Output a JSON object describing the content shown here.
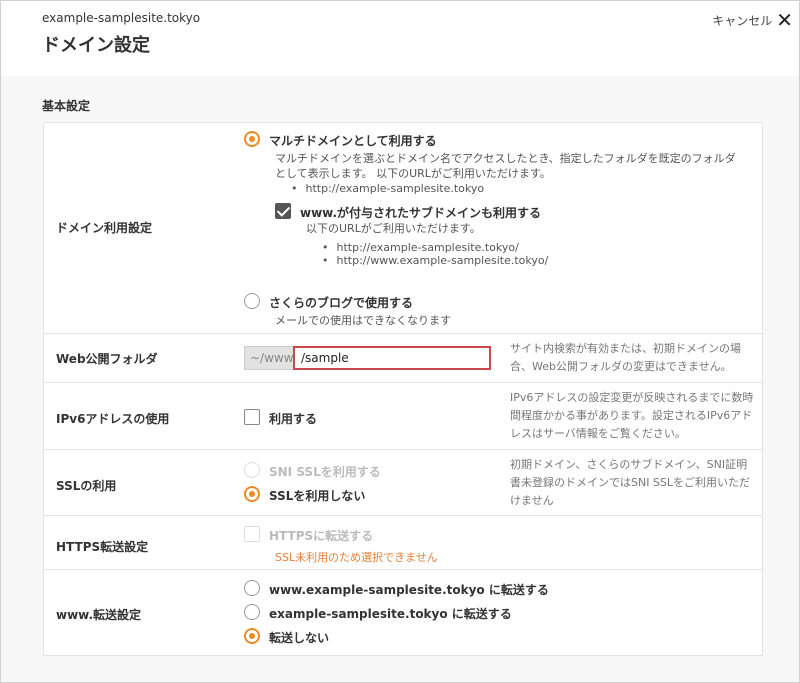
{
  "header": {
    "site_domain": "example-samplesite.tokyo",
    "title": "ドメイン設定",
    "cancel_label": "キャンセル"
  },
  "section_title": "基本設定",
  "domain_usage": {
    "label": "ドメイン利用設定",
    "multi_option": "マルチドメインとして利用する",
    "multi_desc": "マルチドメインを選ぶとドメイン名でアクセスしたとき、指定したフォルダを既定のフォルダとして表示します。 以下のURLがご利用いただけます。",
    "multi_urls": [
      "http://example-samplesite.tokyo"
    ],
    "www_check": "www.が付与されたサブドメインも利用する",
    "www_desc": "以下のURLがご利用いただけます。",
    "www_urls": [
      "http://example-samplesite.tokyo/",
      "http://www.example-samplesite.tokyo/"
    ],
    "blog_option": "さくらのブログで使用する",
    "blog_desc": "メールでの使用はできなくなります"
  },
  "web_folder": {
    "label": "Web公開フォルダ",
    "prefix": "~/www",
    "value": "/sample",
    "note": "サイト内検索が有効または、初期ドメインの場合、Web公開フォルダの変更はできません。"
  },
  "ipv6": {
    "label": "IPv6アドレスの使用",
    "option": "利用する",
    "note": "IPv6アドレスの設定変更が反映されるまでに数時間程度かかる事があります。設定されるIPv6アドレスはサーバ情報をご覧ください。"
  },
  "ssl": {
    "label": "SSLの利用",
    "option_sni": "SNI SSLを利用する",
    "option_none": "SSLを利用しない",
    "note": "初期ドメイン、さくらのサブドメイン、SNI証明書未登録のドメインではSNI SSLをご利用いただけません"
  },
  "https": {
    "label": "HTTPS転送設定",
    "option": "HTTPSに転送する",
    "warning": "SSL未利用のため選択できません"
  },
  "www_redirect": {
    "label": "www.転送設定",
    "option_www": "www.example-samplesite.tokyo に転送する",
    "option_bare": "example-samplesite.tokyo に転送する",
    "option_none": "転送しない"
  },
  "colors": {
    "accent": "#f08a24",
    "input_border": "#c9474d",
    "warning": "#e8813a"
  },
  "icons": {
    "close": "close-icon",
    "radio_selected": "radio-selected-icon",
    "checkbox_checked": "checkbox-checked-icon"
  }
}
